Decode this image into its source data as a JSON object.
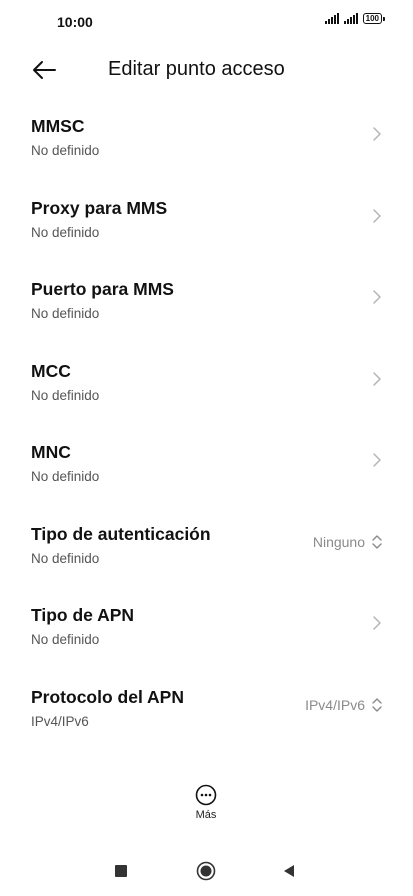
{
  "status_bar": {
    "time": "10:00",
    "battery": "100",
    "icons": [
      "signal-icon",
      "signal-icon",
      "battery-icon"
    ]
  },
  "header": {
    "title": "Editar punto acceso",
    "back_icon": "arrow-left-icon"
  },
  "rows": [
    {
      "label": "MMSC",
      "sub": "No definido",
      "trailing": "chevron-right-icon"
    },
    {
      "label": "Proxy para MMS",
      "sub": "No definido",
      "trailing": "chevron-right-icon"
    },
    {
      "label": "Puerto para MMS",
      "sub": "No definido",
      "trailing": "chevron-right-icon"
    },
    {
      "label": "MCC",
      "sub": "No definido",
      "trailing": "chevron-right-icon"
    },
    {
      "label": "MNC",
      "sub": "No definido",
      "trailing": "chevron-right-icon"
    },
    {
      "label": "Tipo de autenticación",
      "sub": "No definido",
      "value": "Ninguno",
      "trailing": "up-down-icon"
    },
    {
      "label": "Tipo de APN",
      "sub": "No definido",
      "trailing": "chevron-right-icon"
    },
    {
      "label": "Protocolo del APN",
      "sub": "IPv4/IPv6",
      "value": "IPv4/IPv6",
      "trailing": "up-down-icon"
    }
  ],
  "more": {
    "label": "Más",
    "icon": "more-circle-icon"
  },
  "nav": {
    "icons": [
      "recents-icon",
      "home-icon",
      "back-triangle-icon"
    ]
  },
  "colors": {
    "text": "#111111",
    "secondary": "#555555",
    "value": "#8a8a8a",
    "chevron": "#b5b5b5"
  }
}
